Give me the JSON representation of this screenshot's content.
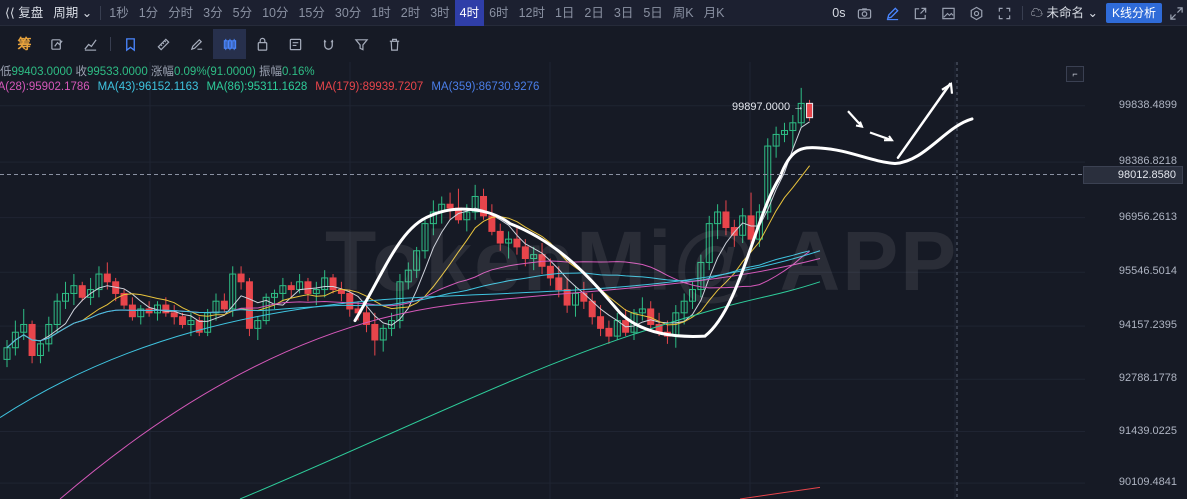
{
  "toolbar": {
    "back_label": "复盘",
    "period_label": "周期",
    "periods": [
      "1秒",
      "1分",
      "分时",
      "3分",
      "5分",
      "10分",
      "15分",
      "30分",
      "1时",
      "2时",
      "3时",
      "4时",
      "6时",
      "12时",
      "1日",
      "2日",
      "3日",
      "5日",
      "周K",
      "月K"
    ],
    "active_period": "4时",
    "countdown": "0s",
    "unnamed_label": "未命名",
    "kline_button": "K线分析"
  },
  "drawbar": {
    "first_label": "筹"
  },
  "info": {
    "low_label": "低",
    "low_value": "99403.0000",
    "close_label": "收",
    "close_value": "99533.0000",
    "change_label": "涨幅",
    "change_value": "0.09%(91.0000)",
    "amp_label": "振幅",
    "amp_value": "0.16%"
  },
  "ma_legend": [
    {
      "text": "MA(28):95902.1786",
      "color": "#d458b9"
    },
    {
      "text": "MA(43):96152.1163",
      "color": "#3fc4e0"
    },
    {
      "text": "MA(86):95311.1628",
      "color": "#2ecc9a"
    },
    {
      "text": "MA(179):89939.7207",
      "color": "#e8454b"
    },
    {
      "text": "MA(359):86730.9276",
      "color": "#4a7ee8"
    }
  ],
  "watermark": "TokenMi@ APP",
  "price_axis": [
    "99838.4899",
    "98386.8218",
    "96956.2613",
    "95546.5014",
    "94157.2395",
    "92788.1778",
    "91439.0225",
    "90109.4841"
  ],
  "crosshair_price": "98012.8580",
  "annotation": "99897.0000",
  "colors": {
    "up": "#2ebd85",
    "down": "#e8454b",
    "bg": "#161a25",
    "accent": "#2f3ea8"
  },
  "chart_data": {
    "type": "candlestick",
    "y_axis_ticks": [
      99838.4899,
      98386.8218,
      96956.2613,
      95546.5014,
      94157.2395,
      92788.1778,
      91439.0225,
      90109.4841
    ],
    "ylim": [
      89700,
      100400
    ],
    "last_high_annotation": 99897.0,
    "candles": [
      [
        93300,
        93800,
        93100,
        93600
      ],
      [
        93600,
        94300,
        93400,
        94000
      ],
      [
        94000,
        94600,
        93800,
        94200
      ],
      [
        94200,
        94300,
        93200,
        93400
      ],
      [
        93400,
        93800,
        93200,
        93700
      ],
      [
        93700,
        94400,
        93500,
        94200
      ],
      [
        94200,
        95000,
        94000,
        94800
      ],
      [
        94800,
        95300,
        94600,
        95000
      ],
      [
        95000,
        95500,
        94700,
        95200
      ],
      [
        95200,
        95300,
        94800,
        94900
      ],
      [
        94900,
        95400,
        94700,
        95100
      ],
      [
        95100,
        95700,
        94900,
        95500
      ],
      [
        95500,
        95800,
        95100,
        95300
      ],
      [
        95300,
        95400,
        94800,
        95000
      ],
      [
        95000,
        95100,
        94600,
        94700
      ],
      [
        94700,
        94900,
        94300,
        94400
      ],
      [
        94400,
        94700,
        94200,
        94600
      ],
      [
        94600,
        94800,
        94400,
        94500
      ],
      [
        94500,
        94800,
        94300,
        94700
      ],
      [
        94700,
        94900,
        94400,
        94500
      ],
      [
        94500,
        94700,
        94200,
        94400
      ],
      [
        94400,
        94500,
        94100,
        94200
      ],
      [
        94200,
        94500,
        93900,
        94300
      ],
      [
        94300,
        94400,
        93900,
        94000
      ],
      [
        94000,
        94600,
        93900,
        94500
      ],
      [
        94500,
        95000,
        94300,
        94800
      ],
      [
        94800,
        95000,
        94500,
        94600
      ],
      [
        94600,
        95700,
        94400,
        95500
      ],
      [
        95500,
        95700,
        95100,
        95300
      ],
      [
        95300,
        95400,
        93900,
        94100
      ],
      [
        94100,
        94400,
        93800,
        94300
      ],
      [
        94300,
        95000,
        94200,
        94900
      ],
      [
        94900,
        95100,
        94600,
        95000
      ],
      [
        95000,
        95400,
        94800,
        95200
      ],
      [
        95200,
        95300,
        94900,
        95100
      ],
      [
        95100,
        95500,
        95000,
        95300
      ],
      [
        95300,
        95400,
        94800,
        95000
      ],
      [
        95000,
        95300,
        94700,
        95100
      ],
      [
        95100,
        95600,
        94900,
        95400
      ],
      [
        95400,
        95500,
        95000,
        95100
      ],
      [
        95100,
        95300,
        94800,
        95000
      ],
      [
        95000,
        95100,
        94400,
        94600
      ],
      [
        94600,
        94800,
        94300,
        94500
      ],
      [
        94500,
        94800,
        94000,
        94200
      ],
      [
        94200,
        94500,
        93400,
        93800
      ],
      [
        93800,
        94200,
        93500,
        94100
      ],
      [
        94100,
        94500,
        93900,
        94300
      ],
      [
        94300,
        95500,
        94100,
        95300
      ],
      [
        95300,
        95800,
        95100,
        95600
      ],
      [
        95600,
        96200,
        95400,
        96100
      ],
      [
        96100,
        96900,
        95900,
        96800
      ],
      [
        96800,
        97400,
        96500,
        97100
      ],
      [
        97100,
        97500,
        96800,
        97300
      ],
      [
        97300,
        97600,
        96900,
        97200
      ],
      [
        97200,
        97700,
        96800,
        96900
      ],
      [
        96900,
        97300,
        96600,
        97100
      ],
      [
        97100,
        97800,
        96900,
        97500
      ],
      [
        97500,
        97700,
        96900,
        97000
      ],
      [
        97000,
        97300,
        96500,
        96600
      ],
      [
        96600,
        96800,
        96100,
        96300
      ],
      [
        96300,
        96600,
        95900,
        96400
      ],
      [
        96400,
        96700,
        96000,
        96200
      ],
      [
        96200,
        96400,
        95700,
        95900
      ],
      [
        95900,
        96200,
        95600,
        96000
      ],
      [
        96000,
        96300,
        95500,
        95700
      ],
      [
        95700,
        95900,
        95200,
        95400
      ],
      [
        95400,
        95700,
        94900,
        95100
      ],
      [
        95100,
        95400,
        94500,
        94700
      ],
      [
        94700,
        95200,
        94400,
        95000
      ],
      [
        95000,
        95300,
        94600,
        94800
      ],
      [
        94800,
        95000,
        94200,
        94400
      ],
      [
        94400,
        94700,
        93900,
        94100
      ],
      [
        94100,
        94300,
        93700,
        93900
      ],
      [
        93900,
        94500,
        93800,
        94300
      ],
      [
        94300,
        94600,
        93900,
        94000
      ],
      [
        94000,
        94600,
        93800,
        94500
      ],
      [
        94500,
        94900,
        94300,
        94600
      ],
      [
        94600,
        94800,
        94100,
        94200
      ],
      [
        94200,
        94500,
        93900,
        94000
      ],
      [
        94000,
        94300,
        93700,
        93900
      ],
      [
        93900,
        94700,
        93600,
        94500
      ],
      [
        94500,
        95000,
        94200,
        94800
      ],
      [
        94800,
        95300,
        94600,
        95100
      ],
      [
        95100,
        96000,
        94900,
        95800
      ],
      [
        95800,
        97000,
        95600,
        96800
      ],
      [
        96800,
        97300,
        96400,
        97100
      ],
      [
        97100,
        97400,
        96500,
        96700
      ],
      [
        96700,
        96900,
        96200,
        96500
      ],
      [
        96500,
        97200,
        96300,
        97000
      ],
      [
        97000,
        97600,
        96200,
        96400
      ],
      [
        96400,
        97300,
        96200,
        97100
      ],
      [
        97100,
        99000,
        96900,
        98800
      ],
      [
        98800,
        99300,
        98500,
        99100
      ],
      [
        99100,
        99400,
        98900,
        99200
      ],
      [
        99200,
        99600,
        98700,
        99400
      ],
      [
        99400,
        100300,
        99300,
        99900
      ],
      [
        99900,
        99990,
        99450,
        99533
      ]
    ]
  }
}
